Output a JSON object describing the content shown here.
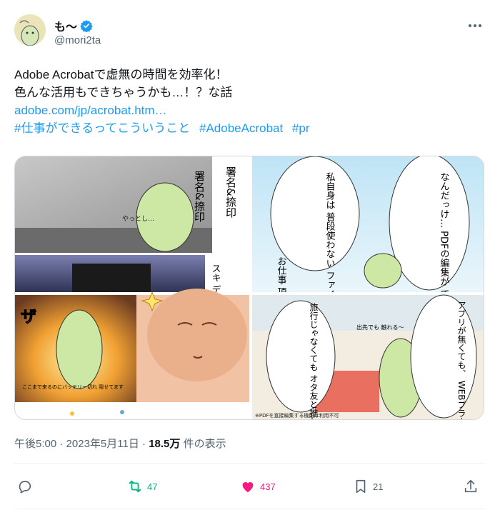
{
  "author": {
    "display_name": "も〜",
    "handle": "@mori2ta",
    "verified": true
  },
  "tweet": {
    "line1": "Adobe Acrobatで虚無の時間を効率化！",
    "line2": "色んな活用もできちゃうかも…！？な話",
    "link": "adobe.com/jp/acrobat.htm…",
    "hashtags": [
      "#仕事ができるってこういうこと",
      "#AdobeAcrobat",
      "#pr"
    ]
  },
  "media": {
    "panel_texts": {
      "sign_stamp": "署名&捺印",
      "yattoshi": "やっとし…",
      "scan_data": "スキ\nデー",
      "za": "ザ",
      "private_use": "私自身は\n普段使わない\nファイル形式\nだけど",
      "pdf_edit": "なんだっけ…\nPDFの編集が\nできるんだっけ？",
      "work": "お仕事\n頂く資\n大体P\nなのと",
      "travel": "旅行じゃなくても\nオタ友と推し語り\nとか…♡",
      "app": "アプリが無くても、\nWEBブラウザから\n作業可能なのもいいね",
      "out": "出先でも\n触れる〜",
      "caption": "※PDFを直接編集する機能は利用不可",
      "knees": "ここまで来るのにバッテリー切れ\n隠せてます"
    }
  },
  "meta": {
    "time": "午後5:00",
    "date": "2023年5月11日",
    "views": "18.5万",
    "views_label": "件の表示"
  },
  "actions": {
    "reply_count": "",
    "retweet_count": "47",
    "like_count": "437",
    "bookmark_count": "21"
  },
  "colors": {
    "link": "#1d9bf0",
    "retweet_active": "#00ba7c",
    "like_active": "#f91880",
    "secondary": "#536471"
  }
}
